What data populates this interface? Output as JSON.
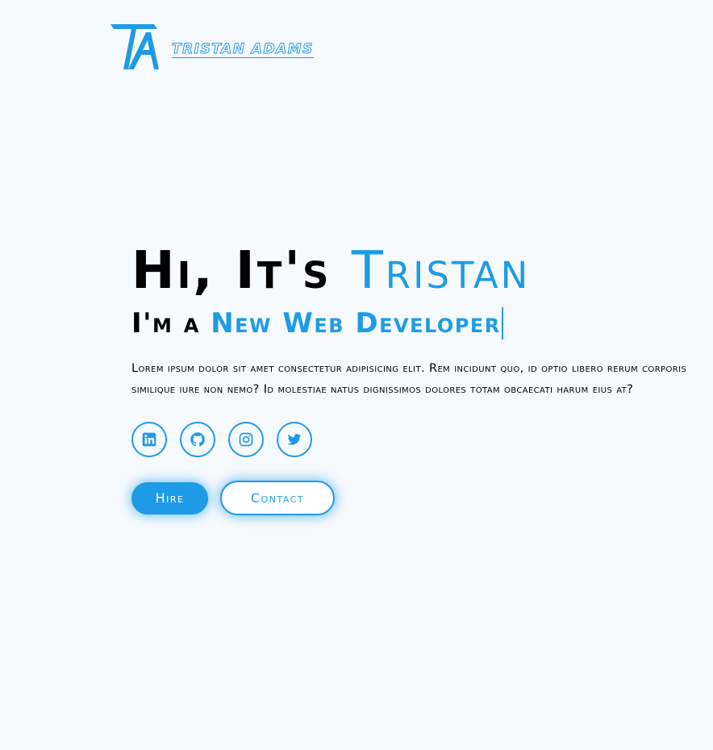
{
  "header": {
    "logo_monogram": "TA",
    "logo_text": "Tristan Adams"
  },
  "hero": {
    "title_lead": "Hi, It's ",
    "title_name": "Tristan",
    "subtitle_lead": "I'm a ",
    "subtitle_typed": "New Web Developer",
    "description": "Lorem ipsum dolor sit amet consectetur adipisicing elit. Rem incidunt quo, id optio libero rerum corporis similique iure non nemo? Id molestiae natus dignissimos dolores totam obcaecati harum eius at?"
  },
  "social": [
    {
      "name": "linkedin",
      "icon": "linkedin-icon"
    },
    {
      "name": "github",
      "icon": "github-icon"
    },
    {
      "name": "instagram",
      "icon": "instagram-icon"
    },
    {
      "name": "twitter",
      "icon": "twitter-icon"
    }
  ],
  "actions": {
    "hire_label": "Hire",
    "contact_label": "Contact"
  },
  "colors": {
    "accent": "#1e9be6",
    "background": "#f7fafd",
    "text": "#000000"
  }
}
